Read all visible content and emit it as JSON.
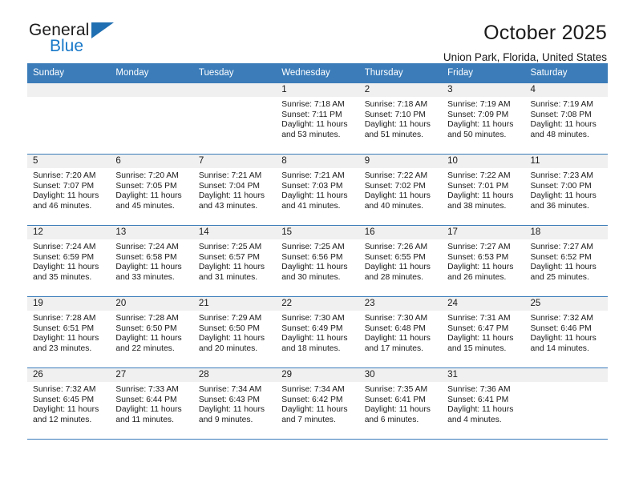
{
  "brand": {
    "name_part1": "General",
    "name_part2": "Blue",
    "accent_color": "#1878c8",
    "triangle_color": "#1f6fb2"
  },
  "header": {
    "title": "October 2025",
    "subtitle": "Union Park, Florida, United States"
  },
  "calendar": {
    "header_color": "#3b7cb9",
    "daynum_bg": "#f0f0f0",
    "weekdays": [
      "Sunday",
      "Monday",
      "Tuesday",
      "Wednesday",
      "Thursday",
      "Friday",
      "Saturday"
    ],
    "weeks": [
      [
        {
          "day": ""
        },
        {
          "day": ""
        },
        {
          "day": ""
        },
        {
          "day": "1",
          "sunrise": "Sunrise: 7:18 AM",
          "sunset": "Sunset: 7:11 PM",
          "daylight": "Daylight: 11 hours and 53 minutes."
        },
        {
          "day": "2",
          "sunrise": "Sunrise: 7:18 AM",
          "sunset": "Sunset: 7:10 PM",
          "daylight": "Daylight: 11 hours and 51 minutes."
        },
        {
          "day": "3",
          "sunrise": "Sunrise: 7:19 AM",
          "sunset": "Sunset: 7:09 PM",
          "daylight": "Daylight: 11 hours and 50 minutes."
        },
        {
          "day": "4",
          "sunrise": "Sunrise: 7:19 AM",
          "sunset": "Sunset: 7:08 PM",
          "daylight": "Daylight: 11 hours and 48 minutes."
        }
      ],
      [
        {
          "day": "5",
          "sunrise": "Sunrise: 7:20 AM",
          "sunset": "Sunset: 7:07 PM",
          "daylight": "Daylight: 11 hours and 46 minutes."
        },
        {
          "day": "6",
          "sunrise": "Sunrise: 7:20 AM",
          "sunset": "Sunset: 7:05 PM",
          "daylight": "Daylight: 11 hours and 45 minutes."
        },
        {
          "day": "7",
          "sunrise": "Sunrise: 7:21 AM",
          "sunset": "Sunset: 7:04 PM",
          "daylight": "Daylight: 11 hours and 43 minutes."
        },
        {
          "day": "8",
          "sunrise": "Sunrise: 7:21 AM",
          "sunset": "Sunset: 7:03 PM",
          "daylight": "Daylight: 11 hours and 41 minutes."
        },
        {
          "day": "9",
          "sunrise": "Sunrise: 7:22 AM",
          "sunset": "Sunset: 7:02 PM",
          "daylight": "Daylight: 11 hours and 40 minutes."
        },
        {
          "day": "10",
          "sunrise": "Sunrise: 7:22 AM",
          "sunset": "Sunset: 7:01 PM",
          "daylight": "Daylight: 11 hours and 38 minutes."
        },
        {
          "day": "11",
          "sunrise": "Sunrise: 7:23 AM",
          "sunset": "Sunset: 7:00 PM",
          "daylight": "Daylight: 11 hours and 36 minutes."
        }
      ],
      [
        {
          "day": "12",
          "sunrise": "Sunrise: 7:24 AM",
          "sunset": "Sunset: 6:59 PM",
          "daylight": "Daylight: 11 hours and 35 minutes."
        },
        {
          "day": "13",
          "sunrise": "Sunrise: 7:24 AM",
          "sunset": "Sunset: 6:58 PM",
          "daylight": "Daylight: 11 hours and 33 minutes."
        },
        {
          "day": "14",
          "sunrise": "Sunrise: 7:25 AM",
          "sunset": "Sunset: 6:57 PM",
          "daylight": "Daylight: 11 hours and 31 minutes."
        },
        {
          "day": "15",
          "sunrise": "Sunrise: 7:25 AM",
          "sunset": "Sunset: 6:56 PM",
          "daylight": "Daylight: 11 hours and 30 minutes."
        },
        {
          "day": "16",
          "sunrise": "Sunrise: 7:26 AM",
          "sunset": "Sunset: 6:55 PM",
          "daylight": "Daylight: 11 hours and 28 minutes."
        },
        {
          "day": "17",
          "sunrise": "Sunrise: 7:27 AM",
          "sunset": "Sunset: 6:53 PM",
          "daylight": "Daylight: 11 hours and 26 minutes."
        },
        {
          "day": "18",
          "sunrise": "Sunrise: 7:27 AM",
          "sunset": "Sunset: 6:52 PM",
          "daylight": "Daylight: 11 hours and 25 minutes."
        }
      ],
      [
        {
          "day": "19",
          "sunrise": "Sunrise: 7:28 AM",
          "sunset": "Sunset: 6:51 PM",
          "daylight": "Daylight: 11 hours and 23 minutes."
        },
        {
          "day": "20",
          "sunrise": "Sunrise: 7:28 AM",
          "sunset": "Sunset: 6:50 PM",
          "daylight": "Daylight: 11 hours and 22 minutes."
        },
        {
          "day": "21",
          "sunrise": "Sunrise: 7:29 AM",
          "sunset": "Sunset: 6:50 PM",
          "daylight": "Daylight: 11 hours and 20 minutes."
        },
        {
          "day": "22",
          "sunrise": "Sunrise: 7:30 AM",
          "sunset": "Sunset: 6:49 PM",
          "daylight": "Daylight: 11 hours and 18 minutes."
        },
        {
          "day": "23",
          "sunrise": "Sunrise: 7:30 AM",
          "sunset": "Sunset: 6:48 PM",
          "daylight": "Daylight: 11 hours and 17 minutes."
        },
        {
          "day": "24",
          "sunrise": "Sunrise: 7:31 AM",
          "sunset": "Sunset: 6:47 PM",
          "daylight": "Daylight: 11 hours and 15 minutes."
        },
        {
          "day": "25",
          "sunrise": "Sunrise: 7:32 AM",
          "sunset": "Sunset: 6:46 PM",
          "daylight": "Daylight: 11 hours and 14 minutes."
        }
      ],
      [
        {
          "day": "26",
          "sunrise": "Sunrise: 7:32 AM",
          "sunset": "Sunset: 6:45 PM",
          "daylight": "Daylight: 11 hours and 12 minutes."
        },
        {
          "day": "27",
          "sunrise": "Sunrise: 7:33 AM",
          "sunset": "Sunset: 6:44 PM",
          "daylight": "Daylight: 11 hours and 11 minutes."
        },
        {
          "day": "28",
          "sunrise": "Sunrise: 7:34 AM",
          "sunset": "Sunset: 6:43 PM",
          "daylight": "Daylight: 11 hours and 9 minutes."
        },
        {
          "day": "29",
          "sunrise": "Sunrise: 7:34 AM",
          "sunset": "Sunset: 6:42 PM",
          "daylight": "Daylight: 11 hours and 7 minutes."
        },
        {
          "day": "30",
          "sunrise": "Sunrise: 7:35 AM",
          "sunset": "Sunset: 6:41 PM",
          "daylight": "Daylight: 11 hours and 6 minutes."
        },
        {
          "day": "31",
          "sunrise": "Sunrise: 7:36 AM",
          "sunset": "Sunset: 6:41 PM",
          "daylight": "Daylight: 11 hours and 4 minutes."
        },
        {
          "day": ""
        }
      ]
    ]
  }
}
